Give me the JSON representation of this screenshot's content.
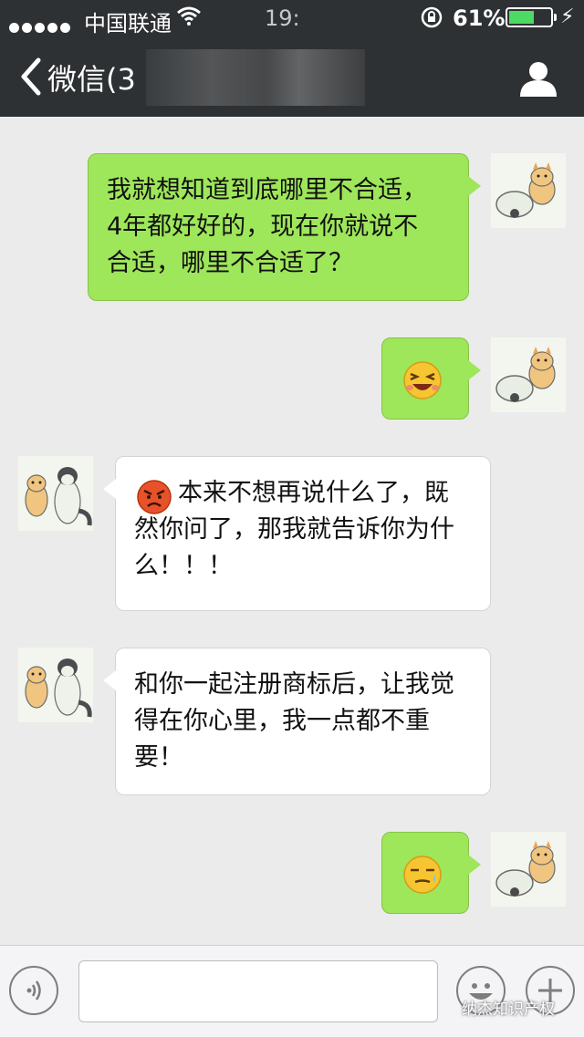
{
  "status_bar": {
    "carrier": "中国联通",
    "time": "19:",
    "battery_percent": "61%",
    "battery_level": 0.61
  },
  "nav": {
    "title": "微信(3",
    "back_icon": "chevron-left-icon",
    "contact_icon": "person-icon"
  },
  "messages": [
    {
      "side": "out",
      "text": "我就想知道到底哪里不合适，\n4年都好好的，现在你就说不\n合适，哪里不合适了？"
    },
    {
      "side": "out",
      "emoji": "laughing-squint-emoji"
    },
    {
      "side": "in",
      "emoji": "angry-face-emoji",
      "text": "本来不想再说什么了，既\n然你问了，那我就告诉你为什\n么！！！"
    },
    {
      "side": "in",
      "text": "和你一起注册商标后，让我觉\n得在你心里，我一点都不重\n要！"
    },
    {
      "side": "out",
      "emoji": "smirk-sweat-emoji"
    }
  ],
  "input_bar": {
    "voice_icon": "voice-icon",
    "emoji_icon": "emoji-face-icon",
    "plus_icon": "plus-icon",
    "value": ""
  },
  "watermark": "纳杰知识产权",
  "colors": {
    "header_bg": "#2e3133",
    "chat_bg": "#ebebeb",
    "outgoing_bubble": "#9ee65a",
    "incoming_bubble": "#ffffff",
    "battery_fill": "#4cd964"
  }
}
